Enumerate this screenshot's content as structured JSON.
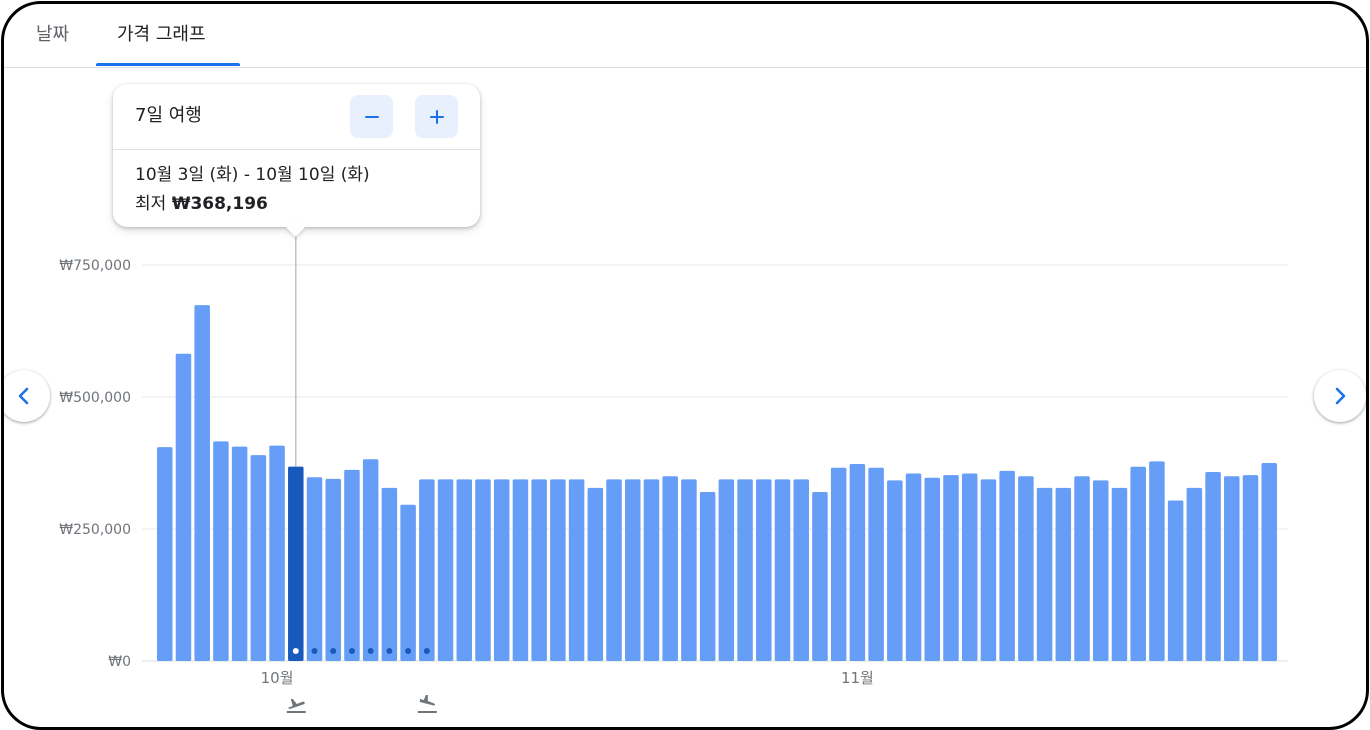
{
  "tabs": [
    {
      "label": "날짜",
      "active": false
    },
    {
      "label": "가격 그래프",
      "active": true
    }
  ],
  "tooltip": {
    "trip_length": "7일 여행",
    "minus_icon": "minus-icon",
    "plus_icon": "plus-icon",
    "dates": "10월 3일 (화) - 10월 10일 (화)",
    "low_prefix": "최저",
    "low_price": "₩368,196"
  },
  "navigation": {
    "prev_icon": "chevron-left-icon",
    "next_icon": "chevron-right-icon"
  },
  "markers": {
    "depart_icon": "flight-takeoff-icon",
    "return_icon": "flight-land-icon"
  },
  "colors": {
    "bar": "#669df6",
    "selected_bar": "#185abc",
    "grid": "#e8eaed",
    "accent": "#1a73e8",
    "text": "#70757a"
  },
  "chart_data": {
    "type": "bar",
    "ylim": [
      0,
      750000
    ],
    "y_ticks": [
      0,
      250000,
      500000,
      750000
    ],
    "y_tick_labels": [
      "₩0",
      "₩250,000",
      "₩500,000",
      "₩750,000"
    ],
    "x_month_labels": [
      {
        "label": "10월",
        "index": 6
      },
      {
        "label": "11월",
        "index": 37
      }
    ],
    "selected_index": 7,
    "trip_dot_indices": [
      8,
      9,
      10,
      11,
      12,
      13,
      14
    ],
    "depart_index": 7,
    "return_index": 14,
    "values": [
      405000,
      582000,
      674000,
      416000,
      406000,
      390000,
      408000,
      368196,
      348000,
      345000,
      362000,
      382000,
      328000,
      296000,
      344000,
      344000,
      344000,
      344000,
      344000,
      344000,
      344000,
      344000,
      344000,
      328000,
      344000,
      344000,
      344000,
      350000,
      344000,
      320000,
      344000,
      344000,
      344000,
      344000,
      344000,
      320000,
      366000,
      373000,
      366000,
      342000,
      355000,
      347000,
      352000,
      355000,
      344000,
      360000,
      350000,
      328000,
      328000,
      350000,
      342000,
      328000,
      368000,
      378000,
      304000,
      328000,
      358000,
      350000,
      352000,
      375000
    ]
  }
}
